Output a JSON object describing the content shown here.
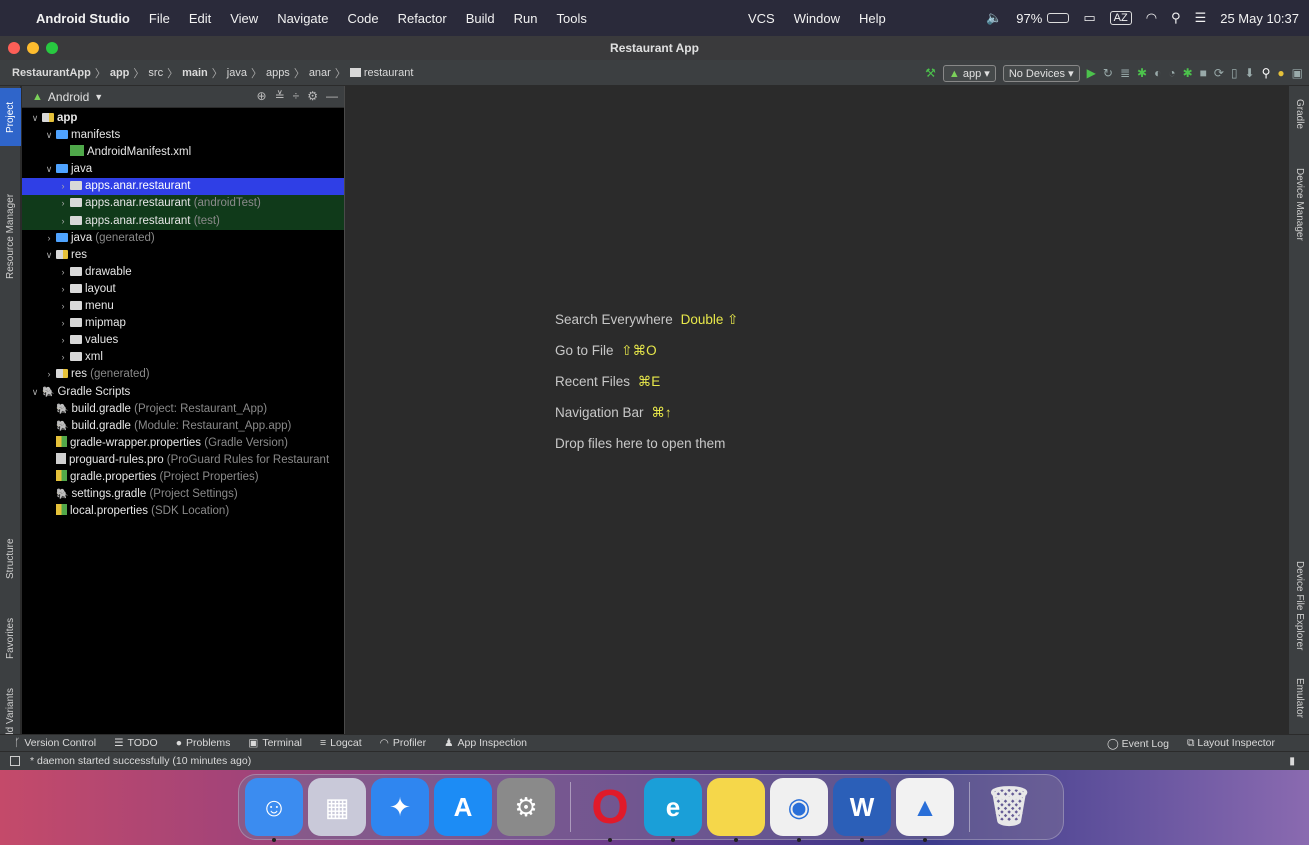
{
  "menubar": {
    "app_name": "Android Studio",
    "menus": [
      "File",
      "Edit",
      "View",
      "Navigate",
      "Code",
      "Refactor",
      "Build",
      "Run",
      "Tools"
    ],
    "right_menus": [
      "VCS",
      "Window",
      "Help"
    ],
    "battery": "97%",
    "input_source": "AZ",
    "datetime": "25 May 10:37"
  },
  "window": {
    "title": "Restaurant App"
  },
  "breadcrumb": {
    "items": [
      "RestaurantApp",
      "app",
      "src",
      "main",
      "java",
      "apps",
      "anar",
      "restaurant"
    ]
  },
  "toolbar": {
    "run_config": "app",
    "device": "No Devices"
  },
  "project_panel": {
    "view_mode": "Android",
    "tree": [
      {
        "label": "app",
        "level": 0,
        "arrow": "v",
        "icon": "folder-app",
        "bold": true
      },
      {
        "label": "manifests",
        "level": 1,
        "arrow": "v",
        "icon": "folder-blue"
      },
      {
        "label": "AndroidManifest.xml",
        "level": 2,
        "arrow": "",
        "icon": "xml"
      },
      {
        "label": "java",
        "level": 1,
        "arrow": "v",
        "icon": "folder-blue"
      },
      {
        "label": "apps.anar.restaurant",
        "level": 2,
        "arrow": ">",
        "icon": "package",
        "selected": true
      },
      {
        "label": "apps.anar.restaurant",
        "suffix": "(androidTest)",
        "level": 2,
        "arrow": ">",
        "icon": "package",
        "test": true
      },
      {
        "label": "apps.anar.restaurant",
        "suffix": "(test)",
        "level": 2,
        "arrow": ">",
        "icon": "package",
        "test": true
      },
      {
        "label": "java",
        "suffix": "(generated)",
        "level": 1,
        "arrow": ">",
        "icon": "folder-blue"
      },
      {
        "label": "res",
        "level": 1,
        "arrow": "v",
        "icon": "folder-res"
      },
      {
        "label": "drawable",
        "level": 2,
        "arrow": ">",
        "icon": "folder-dark"
      },
      {
        "label": "layout",
        "level": 2,
        "arrow": ">",
        "icon": "folder-dark"
      },
      {
        "label": "menu",
        "level": 2,
        "arrow": ">",
        "icon": "folder-dark"
      },
      {
        "label": "mipmap",
        "level": 2,
        "arrow": ">",
        "icon": "folder-dark"
      },
      {
        "label": "values",
        "level": 2,
        "arrow": ">",
        "icon": "folder-dark"
      },
      {
        "label": "xml",
        "level": 2,
        "arrow": ">",
        "icon": "folder-dark"
      },
      {
        "label": "res",
        "suffix": "(generated)",
        "level": 1,
        "arrow": ">",
        "icon": "folder-res"
      },
      {
        "label": "Gradle Scripts",
        "level": 0,
        "arrow": "v",
        "icon": "gradle"
      },
      {
        "label": "build.gradle",
        "suffix": "(Project: Restaurant_App)",
        "level": 1,
        "arrow": "",
        "icon": "gradle"
      },
      {
        "label": "build.gradle",
        "suffix": "(Module: Restaurant_App.app)",
        "level": 1,
        "arrow": "",
        "icon": "gradle"
      },
      {
        "label": "gradle-wrapper.properties",
        "suffix": "(Gradle Version)",
        "level": 1,
        "arrow": "",
        "icon": "props"
      },
      {
        "label": "proguard-rules.pro",
        "suffix": "(ProGuard Rules for Restaurant",
        "level": 1,
        "arrow": "",
        "icon": "pro"
      },
      {
        "label": "gradle.properties",
        "suffix": "(Project Properties)",
        "level": 1,
        "arrow": "",
        "icon": "props"
      },
      {
        "label": "settings.gradle",
        "suffix": "(Project Settings)",
        "level": 1,
        "arrow": "",
        "icon": "gradle"
      },
      {
        "label": "local.properties",
        "suffix": "(SDK Location)",
        "level": 1,
        "arrow": "",
        "icon": "props"
      }
    ]
  },
  "left_tabs": [
    "Project",
    "Resource Manager",
    "Structure",
    "Favorites",
    "Build Variants"
  ],
  "right_tabs": [
    "Gradle",
    "Device Manager",
    "Device File Explorer",
    "Emulator"
  ],
  "editor_hints": [
    {
      "label": "Search Everywhere",
      "key": "Double ⇧"
    },
    {
      "label": "Go to File",
      "key": "⇧⌘O"
    },
    {
      "label": "Recent Files",
      "key": "⌘E"
    },
    {
      "label": "Navigation Bar",
      "key": "⌘↑"
    },
    {
      "label": "Drop files here to open them",
      "key": ""
    }
  ],
  "bottom_tools": [
    "Version Control",
    "TODO",
    "Problems",
    "Terminal",
    "Logcat",
    "Profiler",
    "App Inspection"
  ],
  "bottom_right_tools": [
    "Event Log",
    "Layout Inspector"
  ],
  "status_message": "* daemon started successfully (10 minutes ago)",
  "dock_apps": [
    {
      "name": "Finder",
      "icon": "finder-icon",
      "color": "#3b8cf0",
      "running": true
    },
    {
      "name": "Launchpad",
      "icon": "launchpad-icon",
      "color": "#c9c9d9",
      "running": false
    },
    {
      "name": "Safari",
      "icon": "safari-icon",
      "color": "#2f86f0",
      "running": false
    },
    {
      "name": "App Store",
      "icon": "appstore-icon",
      "color": "#1c8cf5",
      "running": false
    },
    {
      "name": "System Preferences",
      "icon": "settings-icon",
      "color": "#8a8a8a",
      "running": false
    },
    {
      "name": "Opera",
      "icon": "opera-icon",
      "color": "#e01a2a",
      "running": true
    },
    {
      "name": "Edge",
      "icon": "edge-icon",
      "color": "#1a9fd8",
      "running": true
    },
    {
      "name": "Notes",
      "icon": "notes-icon",
      "color": "#f5d74a",
      "running": true
    },
    {
      "name": "Chrome",
      "icon": "chrome-icon",
      "color": "#f0f0f0",
      "running": true
    },
    {
      "name": "Word",
      "icon": "word-icon",
      "color": "#2b5fb8",
      "running": true
    },
    {
      "name": "Android Studio",
      "icon": "android-studio-icon",
      "color": "#f2f2f2",
      "running": true
    },
    {
      "name": "Trash",
      "icon": "trash-icon",
      "color": "#d8d8d8",
      "running": false
    }
  ]
}
